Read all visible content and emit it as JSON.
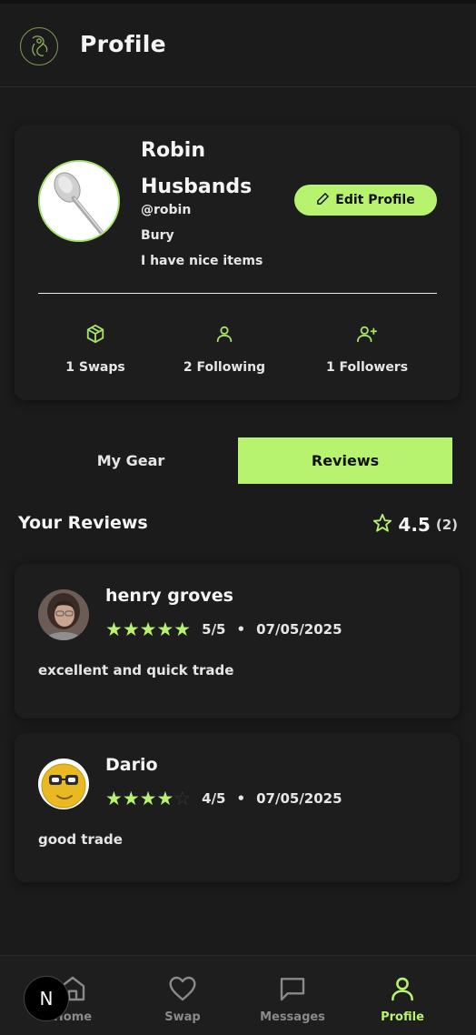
{
  "header": {
    "title": "Profile",
    "logo_icon": "logo-emblem-icon"
  },
  "profile": {
    "name": "Robin Husbands",
    "handle": "@robin",
    "location": "Bury",
    "bio": "I have nice items",
    "avatar": "spoon-image",
    "edit_label": "Edit Profile"
  },
  "stats": [
    {
      "label": "1 Swaps",
      "icon": "box-icon"
    },
    {
      "label": "2 Following",
      "icon": "user-icon"
    },
    {
      "label": "1 Followers",
      "icon": "user-plus-icon"
    }
  ],
  "tabs": [
    {
      "label": "My Gear",
      "active": false
    },
    {
      "label": "Reviews",
      "active": true
    }
  ],
  "reviews_section": {
    "title": "Your Reviews",
    "average": "4.5",
    "count": "(2)"
  },
  "reviews": [
    {
      "name": "henry groves",
      "stars": 5,
      "score": "5/5",
      "date": "07/05/2025",
      "text": "excellent and quick trade"
    },
    {
      "name": "Dario",
      "stars": 4,
      "score": "4/5",
      "date": "07/05/2025",
      "text": "good trade"
    }
  ],
  "separator": "•",
  "nav": [
    {
      "label": "Home",
      "icon": "home-icon",
      "active": false
    },
    {
      "label": "Swap",
      "icon": "heart-icon",
      "active": false
    },
    {
      "label": "Messages",
      "icon": "chat-icon",
      "active": false
    },
    {
      "label": "Profile",
      "icon": "user-icon",
      "active": true
    }
  ],
  "badge": "N",
  "colors": {
    "accent": "#b8f36f",
    "background": "#1b1b1b",
    "card": "#1d1d1d"
  }
}
